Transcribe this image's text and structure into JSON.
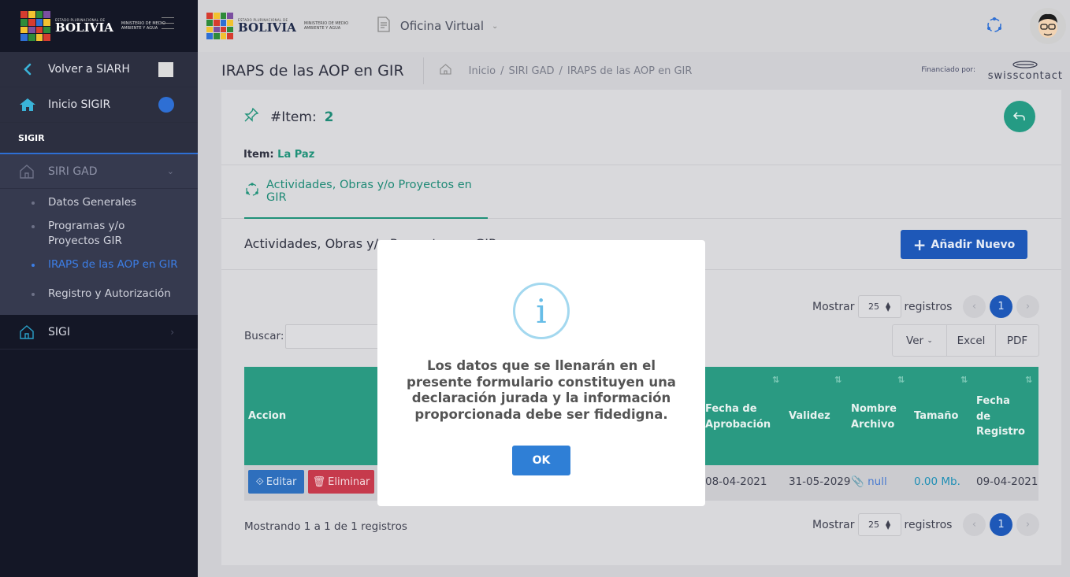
{
  "sidebar": {
    "brand_small": "ESTADO PLURINACIONAL DE",
    "brand_big": "BOLIVIA",
    "ministry": "MINISTERIO DE MEDIO AMBIENTE Y AGUA",
    "back_label": "Volver a SIARH",
    "home_label": "Inicio SIGIR",
    "section_label": "SIGIR",
    "group_label": "SIRI GAD",
    "sub_items": [
      "Datos Generales",
      "Programas y/o Proyectos GIR",
      "IRAPS de las AOP en GIR",
      "Registro y Autorización"
    ],
    "sigi_label": "SIGI"
  },
  "header": {
    "brand_small": "ESTADO PLURINACIONAL DE",
    "brand_big": "BOLIVIA",
    "ministry": "MINISTERIO DE MEDIO AMBIENTE Y AGUA",
    "app_label": "Oficina Virtual"
  },
  "page": {
    "title": "IRAPS de las AOP en GIR",
    "breadcrumb": [
      "Inicio",
      "SIRI GAD",
      "IRAPS de las AOP en GIR"
    ],
    "funded_by": "Financiado por:",
    "sponsor": "swisscontact"
  },
  "item": {
    "label": "#Item:",
    "number": "2",
    "name_label": "Item:",
    "name_value": "La Paz"
  },
  "tab": {
    "label": "Actividades, Obras y/o Proyectos en GIR"
  },
  "section": {
    "title": "Actividades, Obras y/o Proyectos en GIR",
    "add_label": "Añadir Nuevo"
  },
  "table_controls": {
    "show_label": "Mostrar",
    "page_size": "25",
    "records_label": "registros",
    "search_label": "Buscar:",
    "search_value": "",
    "page_prev": "‹",
    "page_current": "1",
    "page_next": "›",
    "export_buttons": [
      "Ver",
      "Excel",
      "PDF"
    ]
  },
  "table": {
    "columns": [
      "Accion",
      "Fecha de Aprobación",
      "Validez",
      "Nombre Archivo",
      "Tamaño",
      "Fecha de Registro"
    ],
    "row": {
      "edit_label": "Editar",
      "delete_label": "Eliminar",
      "fecha_aprobacion": "08-04-2021",
      "validez": "31-05-2029",
      "archivo": "null",
      "tamano": "0.00 Mb.",
      "fecha_registro": "09-04-2021"
    },
    "summary": "Mostrando 1 a 1 de 1 registros"
  },
  "modal": {
    "icon": "i",
    "message": "Los datos que se llenarán en el presente formulario constituyen una declaración jurada y la información proporcionada debe ser fidedigna.",
    "ok_label": "OK"
  }
}
